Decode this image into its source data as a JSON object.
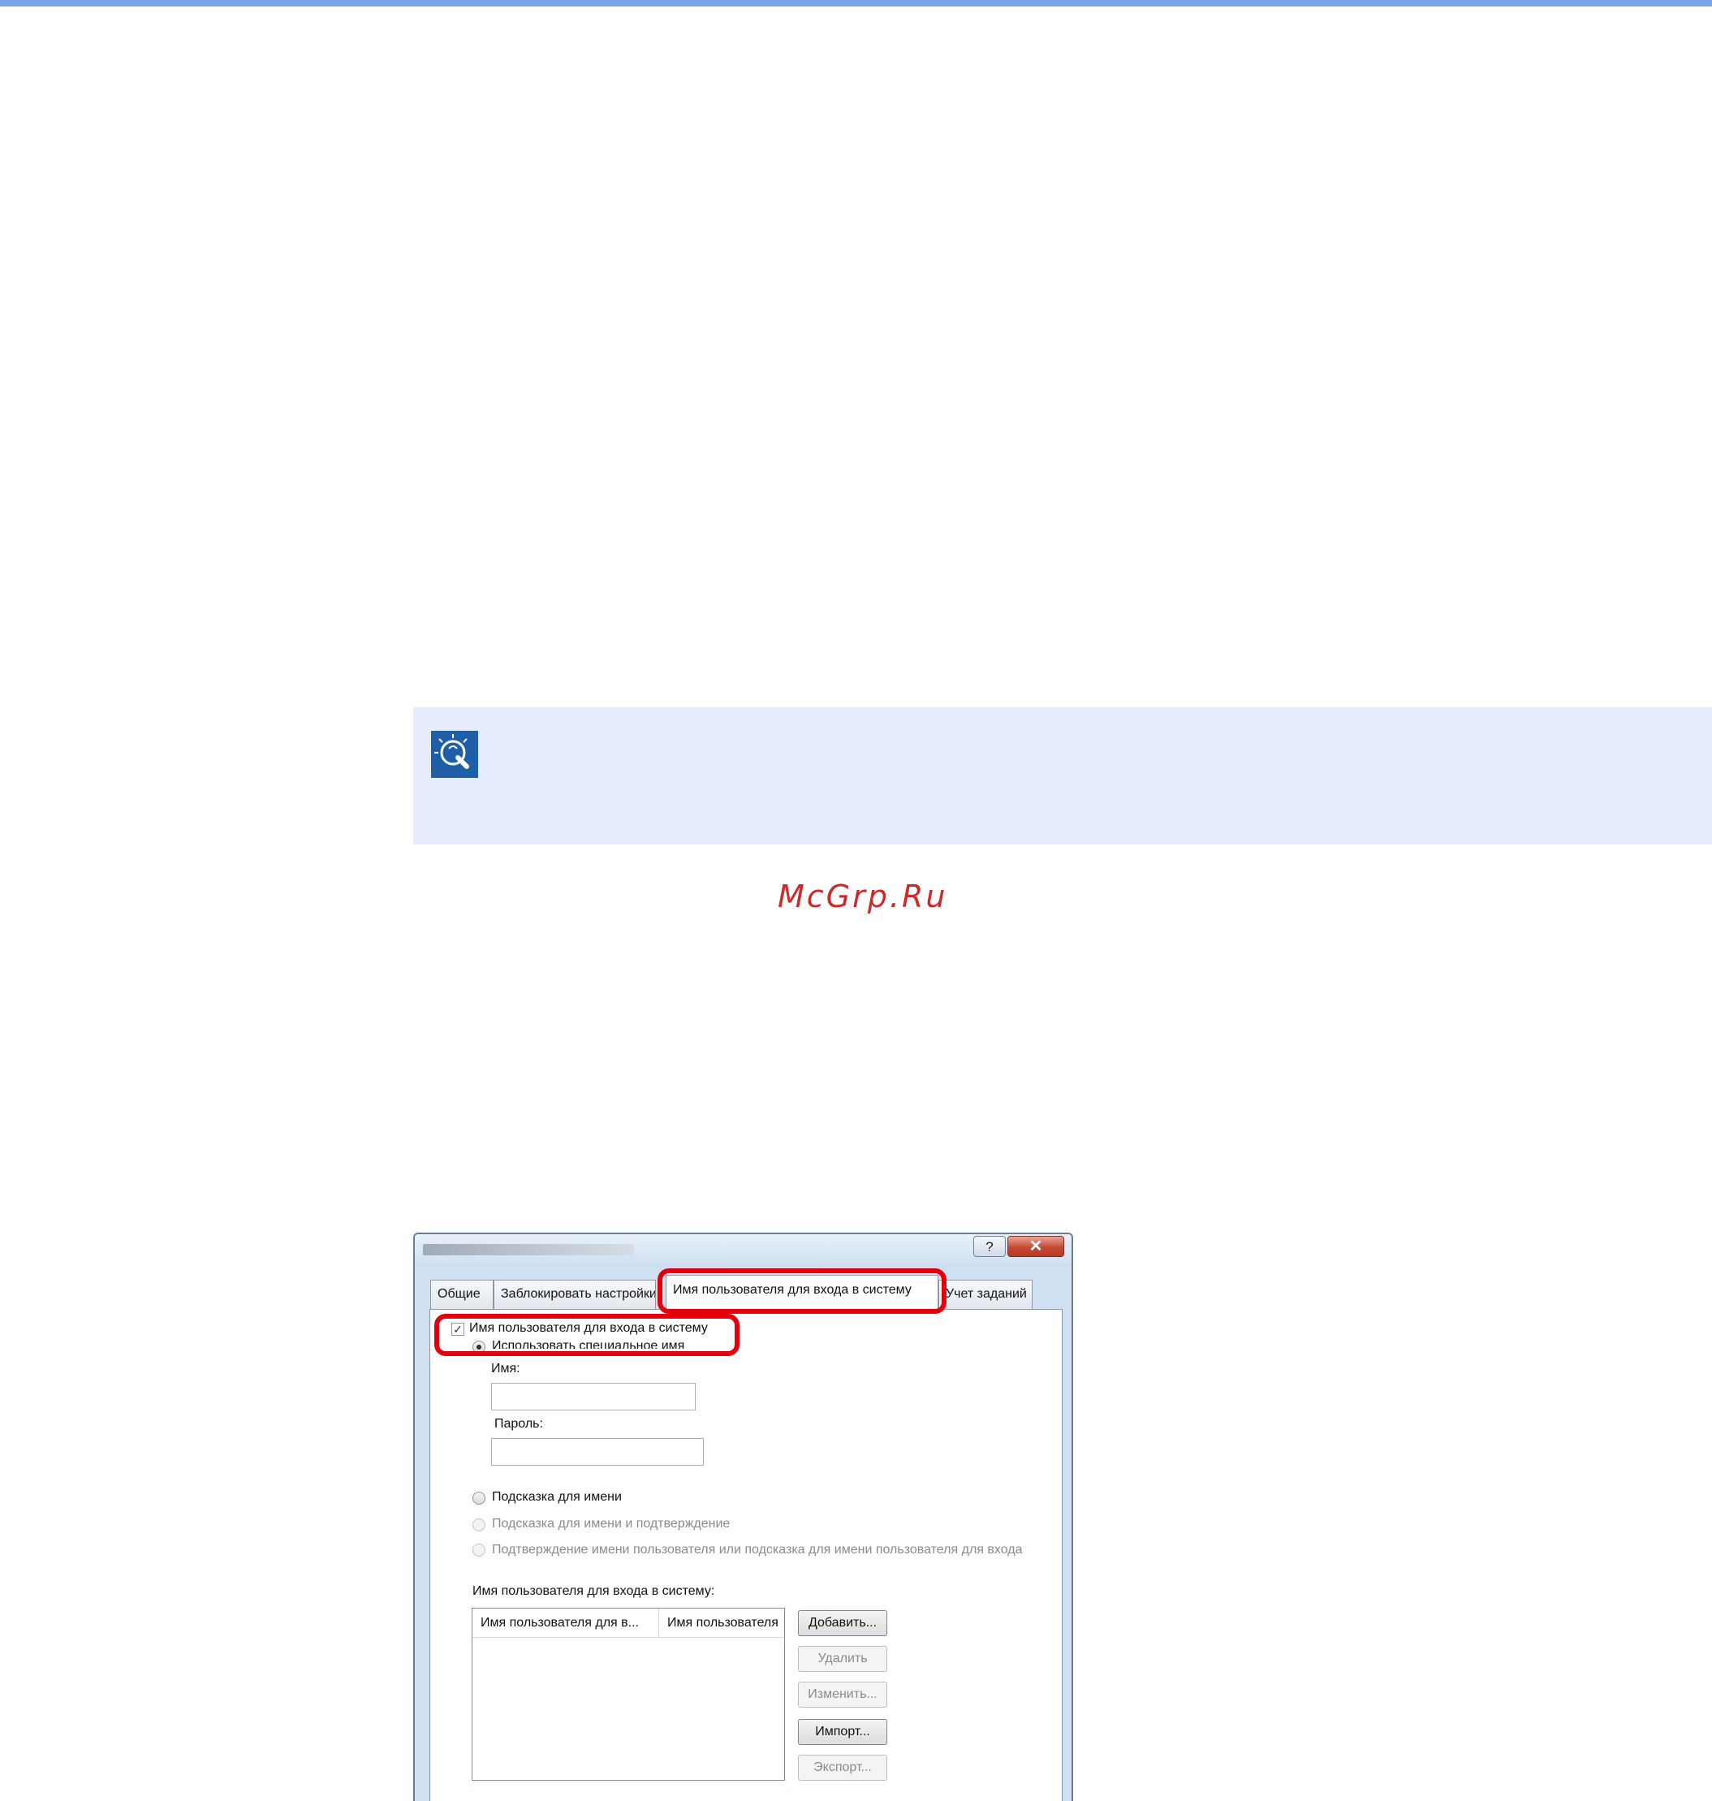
{
  "note": {
    "icon": "lightbulb-hint-icon"
  },
  "watermark": "McGrp.Ru",
  "dialog": {
    "title": "",
    "help_label": "?",
    "close_label": "✕",
    "tabs": [
      {
        "label": "Общие"
      },
      {
        "label": "Заблокировать настройки"
      },
      {
        "label": "Имя пользователя для входа в систему"
      },
      {
        "label": "Учет заданий"
      }
    ],
    "login_checkbox": {
      "label": "Имя пользователя для входа в систему",
      "checked": true
    },
    "radio_custom": {
      "label": "Использовать специальное имя",
      "selected": true
    },
    "name_label": "Имя:",
    "name_value": "",
    "password_label": "Пароль:",
    "password_value": "",
    "radio_prompt": "Подсказка для имени",
    "radio_prompt_confirm": "Подсказка для имени и подтверждение",
    "radio_verify": "Подтверждение имени пользователя или подсказка для имени пользователя для входа",
    "list_caption": "Имя пользователя для входа в систему:",
    "list_columns": [
      "Имя пользователя для в...",
      "Имя пользователя"
    ],
    "buttons": {
      "add": "Добавить...",
      "delete": "Удалить",
      "edit": "Изменить...",
      "import": "Импорт...",
      "export": "Экспорт..."
    }
  },
  "colors": {
    "highlight": "#e3000b",
    "accent_bar": "#7ba4e6",
    "note_bg": "#e5eefa",
    "watermark": "#cc2a2a"
  }
}
